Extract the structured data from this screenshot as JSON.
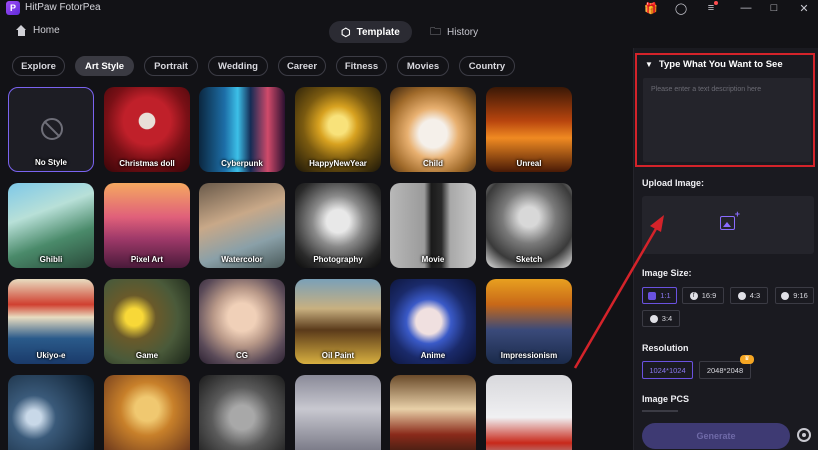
{
  "app": {
    "title": "HitPaw FotorPea"
  },
  "titlebar": {
    "icons": [
      "gift-icon",
      "user-icon",
      "menu-icon",
      "minimize-icon",
      "maximize-icon",
      "close-icon"
    ]
  },
  "nav": {
    "home": "Home",
    "tabs": [
      {
        "label": "Template",
        "icon": "cube-icon"
      },
      {
        "label": "History",
        "icon": "folder-icon"
      }
    ]
  },
  "categories": [
    "Explore",
    "Art Style",
    "Portrait",
    "Wedding",
    "Career",
    "Fitness",
    "Movies",
    "Country"
  ],
  "styles": [
    "No Style",
    "Christmas doll",
    "Cyberpunk",
    "HappyNewYear",
    "Child",
    "Unreal",
    "Ghibli",
    "Pixel Art",
    "Watercolor",
    "Photography",
    "Movie",
    "Sketch",
    "Ukiyo-e",
    "Game",
    "CG",
    "Oil Paint",
    "Anime",
    "Impressionism",
    "",
    "",
    "",
    "",
    "",
    ""
  ],
  "panel": {
    "type_header": "Type What You Want to See",
    "type_placeholder": "Please enter a text description here",
    "upload_label": "Upload Image:",
    "size_label": "Image Size:",
    "sizes": [
      "1:1",
      "16:9",
      "4:3",
      "9:16",
      "3:4"
    ],
    "resolution_label": "Resolution",
    "resolutions": [
      "1024*1024",
      "2048*2048"
    ],
    "pcs_label": "Image PCS",
    "generate": "Generate"
  },
  "colors": {
    "accent": "#6a52e0",
    "highlight_box": "#d4232a",
    "background": "#121216"
  }
}
